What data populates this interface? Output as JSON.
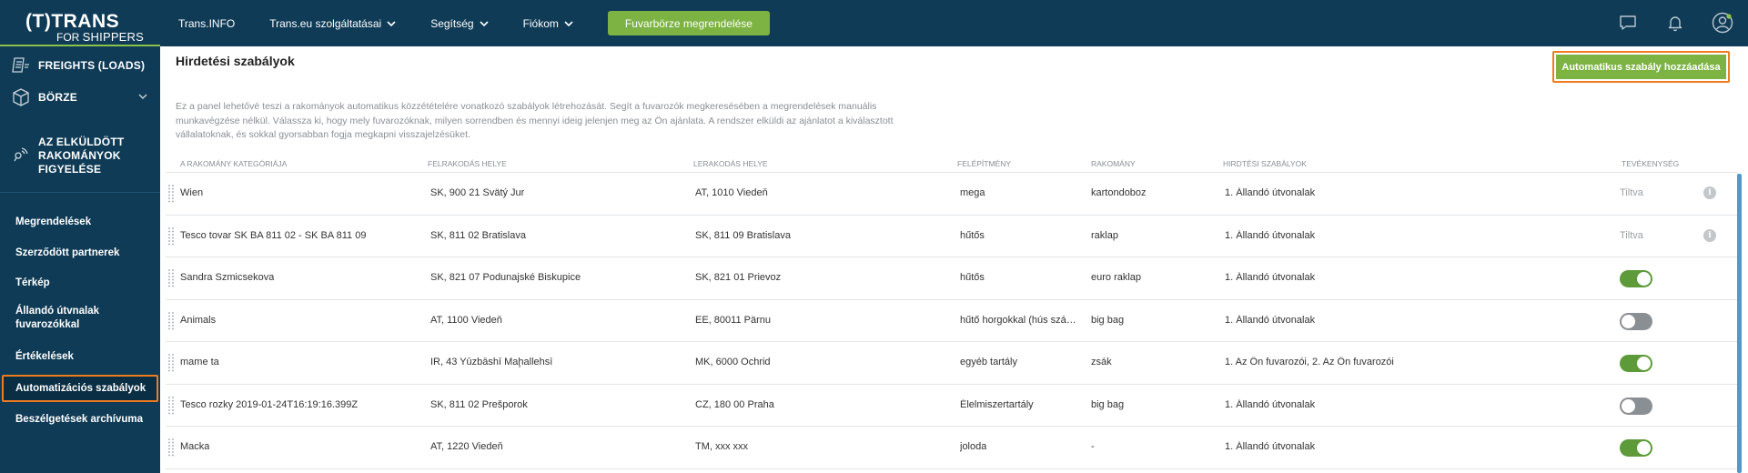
{
  "logo": {
    "line1": "(T)TRANS",
    "line2a": "FOR ",
    "line2b": "SHIPPERS"
  },
  "topnav": {
    "items": [
      {
        "label": "Trans.INFO",
        "has_dropdown": false
      },
      {
        "label": "Trans.eu szolgáltatásai",
        "has_dropdown": true
      },
      {
        "label": "Segítség",
        "has_dropdown": true
      },
      {
        "label": "Fiókom",
        "has_dropdown": true
      }
    ],
    "order_button": "Fuvarbörze megrendelése",
    "icons": [
      "chat-icon",
      "bell-icon",
      "user-avatar-icon"
    ]
  },
  "sidebar": {
    "main": [
      {
        "label": "FREIGHTS (LOADS)",
        "icon": "freights-icon"
      },
      {
        "label": "BÖRZE",
        "icon": "box-icon",
        "expandable": true
      },
      {
        "label": "AZ ELKÜLDÖTT RAKOMÁNYOK FIGYELÉSE",
        "lines": [
          "AZ ELKÜLDÖTT",
          "RAKOMÁNYOK",
          "FIGYELÉSE"
        ],
        "icon": "tracking-icon"
      }
    ],
    "sub": [
      {
        "label": "Megrendelések"
      },
      {
        "label": "Szerződött partnerek"
      },
      {
        "label": "Térkép"
      },
      {
        "label": "Állandó útvnalak fuvarozókkal",
        "lines": [
          "Állandó útvnalak",
          "fuvarozókkal"
        ]
      },
      {
        "label": "Értékelések"
      },
      {
        "label": "Automatizációs szabályok",
        "active": true
      },
      {
        "label": "Beszélgetések archívuma"
      }
    ]
  },
  "page": {
    "title": "Hirdetési szabályok",
    "add_button": "Automatikus szabály hozzáadása",
    "description": "Ez a panel lehetővé teszi a rakományok automatikus közzétételére vonatkozó szabályok létrehozását. Segít a fuvarozók megkeresésében a megrendelések manuális munkavégzése nélkül. Válassza ki, hogy mely fuvarozóknak, milyen sorrendben és mennyi ideig jelenjen meg az Ön ajánlata. A rendszer elküldi az ajánlatot a kiválasztott vállalatoknak, és sokkal gyorsabban fogja megkapni visszajelzésüket."
  },
  "table": {
    "headers": [
      "A RAKOMÁNY KATEGÓRIÁJA",
      "FELRAKODÁS HELYE",
      "LERAKODÁS HELYE",
      "FELÉPÍTMÉNY",
      "RAKOMÁNY",
      "HIRDTÉSI SZABÁLYOK",
      "TEVÉKENYSÉG"
    ],
    "rows": [
      {
        "category": "Wien",
        "loading": "SK, 900 21 Svätý Jur",
        "unloading": "AT, 1010 Viedeň",
        "body": "mega",
        "cargo": "kartondoboz",
        "rules": "1. Állandó útvonalak",
        "status": "disabled",
        "status_text": "Tiltva"
      },
      {
        "category": "Tesco tovar SK BA 811 02 - SK BA 811 09",
        "loading": "SK, 811 02 Bratislava",
        "unloading": "SK, 811 09 Bratislava",
        "body": "hűtős",
        "cargo": "raklap",
        "rules": "1. Állandó útvonalak",
        "status": "disabled",
        "status_text": "Tiltva"
      },
      {
        "category": "Sandra Szmicsekova",
        "loading": "SK, 821 07 Podunajské Biskupice",
        "unloading": "SK, 821 01 Prievoz",
        "body": "hűtős",
        "cargo": "euro raklap",
        "rules": "1. Állandó útvonalak",
        "status": "on"
      },
      {
        "category": "Animals",
        "loading": "AT, 1100 Viedeň",
        "unloading": "EE, 80011 Pärnu",
        "body": "hűtő horgokkal (hús száll…",
        "cargo": "big bag",
        "rules": "1. Állandó útvonalak",
        "status": "off"
      },
      {
        "category": "mame ta",
        "loading": "IR, 43 Yūzbāshī Maḩallehsī",
        "unloading": "MK, 6000 Ochrid",
        "body": "egyéb tartály",
        "cargo": "zsák",
        "rules": "1. Az Ön fuvarozói, 2. Az Ön fuvarozói",
        "status": "on"
      },
      {
        "category": "Tesco rozky 2019-01-24T16:19:16.399Z",
        "loading": "SK, 811 02 Prešporok",
        "unloading": "CZ, 180 00 Praha",
        "body": "Élelmiszertartály",
        "cargo": "big bag",
        "rules": "1. Állandó útvonalak",
        "status": "off"
      },
      {
        "category": "Macka",
        "loading": "AT, 1220 Viedeň",
        "unloading": "TM, xxx xxx",
        "body": "joloda",
        "cargo": "-",
        "rules": "1. Állandó útvonalak",
        "status": "on"
      }
    ]
  },
  "colors": {
    "navy": "#0f3b56",
    "green": "#7cb342",
    "toggle_on": "#5d9b3a",
    "highlight": "#f07c1f"
  }
}
